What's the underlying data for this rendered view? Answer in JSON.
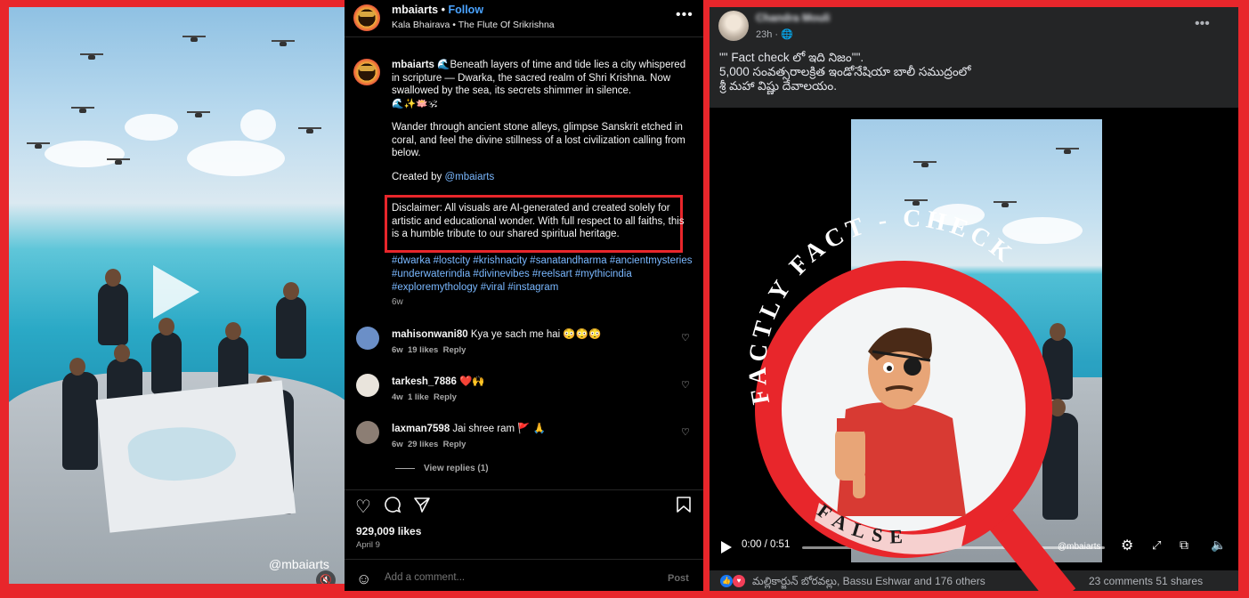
{
  "instagram": {
    "video": {
      "watermark": "@mbaiarts"
    },
    "header": {
      "username": "mbaiarts",
      "separator": "•",
      "follow_label": "Follow",
      "audio": "Kala Bhairava • The Flute Of Srikrishna"
    },
    "caption": {
      "username": "mbaiarts",
      "p1": "🌊Beneath layers of time and tide lies a city whispered in scripture — Dwarka, the sacred realm of Shri Krishna. Now swallowed by the sea, its secrets shimmer in silence.",
      "emojis": "🌊✨🪷🕉",
      "p2": "Wander through ancient stone alleys, glimpse Sanskrit etched in coral, and feel the divine stillness of a lost civilization calling from below.",
      "created_by_label": "Created by",
      "created_by_mention": "@mbaiarts",
      "disclaimer": "Disclaimer: All visuals are AI-generated and created solely for artistic and educational wonder. With full respect to all faiths, this is a humble tribute to our shared spiritual heritage.",
      "hashtags": "#dwarka #lostcity #krishnacity #sanatandharma #ancientmysteries #underwaterindia #divinevibes #reelsart #mythicindia #exploremythology #viral #instagram",
      "age": "6w"
    },
    "comments": [
      {
        "username": "mahisonwani80",
        "text": "Kya ye sach me hai 😳😳😳",
        "age": "6w",
        "likes": "19 likes",
        "reply": "Reply",
        "avatar_color": "#6b8fc7"
      },
      {
        "username": "tarkesh_7886",
        "text": "❤️🙌",
        "age": "4w",
        "likes": "1 like",
        "reply": "Reply",
        "avatar_color": "#e9e4dc"
      },
      {
        "username": "laxman7598",
        "text": "Jai shree ram 🚩 🙏",
        "age": "6w",
        "likes": "29 likes",
        "reply": "Reply",
        "avatar_color": "#8c7e74"
      }
    ],
    "view_replies": "View replies (1)",
    "likes_count": "929,009 likes",
    "post_date": "April 9",
    "add_comment_placeholder": "Add a comment...",
    "post_button": "Post"
  },
  "facebook": {
    "author_name": "Chandra Mouli",
    "time": "23h · 🌐",
    "post_text_line1": "\"\" Fact check లో ఇది నిజం\"\".",
    "post_text_line2": "5,000 సంవత్సరాలక్రిత ఇండోనేషియా బాలీ సముద్రంలో",
    "post_text_line3": "శ్రీ మహా విష్ణు దేవాలయం.",
    "video_watermark": "@mbaiarts",
    "timecode": "0:00 / 0:51",
    "likers": "మల్లికార్జున్ బోరవల్లు, Bassu Eshwar and 176 others",
    "comments_shares": "23 comments  51 shares",
    "colors": {
      "like": "#1877f2",
      "love": "#f33e58"
    }
  },
  "stamp": {
    "arc_text": "FACTLY FACT - CHECK",
    "verdict": "FALSE",
    "ring_color": "#e8262b",
    "banner_color": "#f6d0cf"
  }
}
